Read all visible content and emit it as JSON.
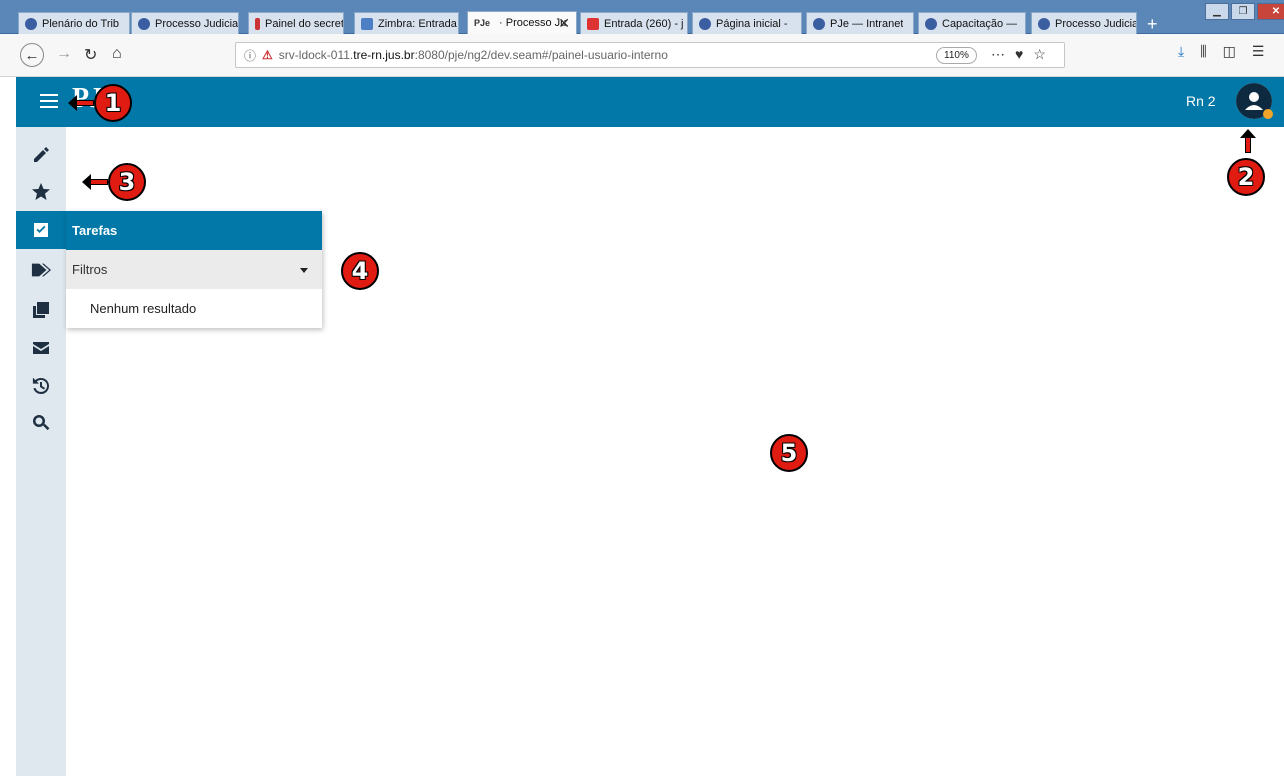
{
  "browser": {
    "tabs": [
      {
        "label": "Plenário do Trib",
        "icon": "pje-tab-icon"
      },
      {
        "label": "Processo Judicia",
        "icon": "pje-tab-icon"
      },
      {
        "label": "Painel do secret",
        "icon": "red-tab-icon"
      },
      {
        "label": "Zimbra: Entrada",
        "icon": "zimbra-tab-icon"
      },
      {
        "label": "· Processo Ju",
        "icon": "pje-badge-icon",
        "badge": "PJe",
        "active": true
      },
      {
        "label": "Entrada (260) - j",
        "icon": "mail-tab-icon"
      },
      {
        "label": "Página inicial -",
        "icon": "pje-tab-icon"
      },
      {
        "label": "PJe — Intranet",
        "icon": "pje-tab-icon"
      },
      {
        "label": "Capacitação —",
        "icon": "pje-tab-icon"
      },
      {
        "label": "Processo Judicia",
        "icon": "pje-tab-icon"
      }
    ],
    "new_tab": "+",
    "url": {
      "prefix": "srv-ldock-011.",
      "host": "tre-rn.jus.br",
      "suffix": ":8080/pje/ng2/dev.seam#/painel-usuario-interno"
    },
    "zoom": "110%",
    "url_icons": [
      "more-icon",
      "pocket-icon",
      "bookmark-star-icon"
    ],
    "right_icons": [
      "download-icon",
      "library-icon",
      "sidebar-icon",
      "menu-icon"
    ]
  },
  "app": {
    "logo": "PJ",
    "user_name": "Rn 2",
    "accent_color": "#0278a8",
    "status_color": "#f0a52a",
    "sidebar": [
      {
        "name": "edit",
        "icon": "pencil-icon"
      },
      {
        "name": "favorites",
        "icon": "star-icon"
      },
      {
        "name": "tasks",
        "icon": "checkbox-icon",
        "active": true
      },
      {
        "name": "tags",
        "icon": "tags-icon"
      },
      {
        "name": "documents",
        "icon": "copy-icon"
      },
      {
        "name": "messages",
        "icon": "envelope-icon"
      },
      {
        "name": "history",
        "icon": "history-icon"
      },
      {
        "name": "search",
        "icon": "search-icon"
      }
    ],
    "flyout": {
      "title": "Tarefas",
      "filter_label": "Filtros",
      "empty_message": "Nenhum resultado"
    }
  },
  "callouts": [
    "1",
    "2",
    "3",
    "4",
    "5"
  ]
}
